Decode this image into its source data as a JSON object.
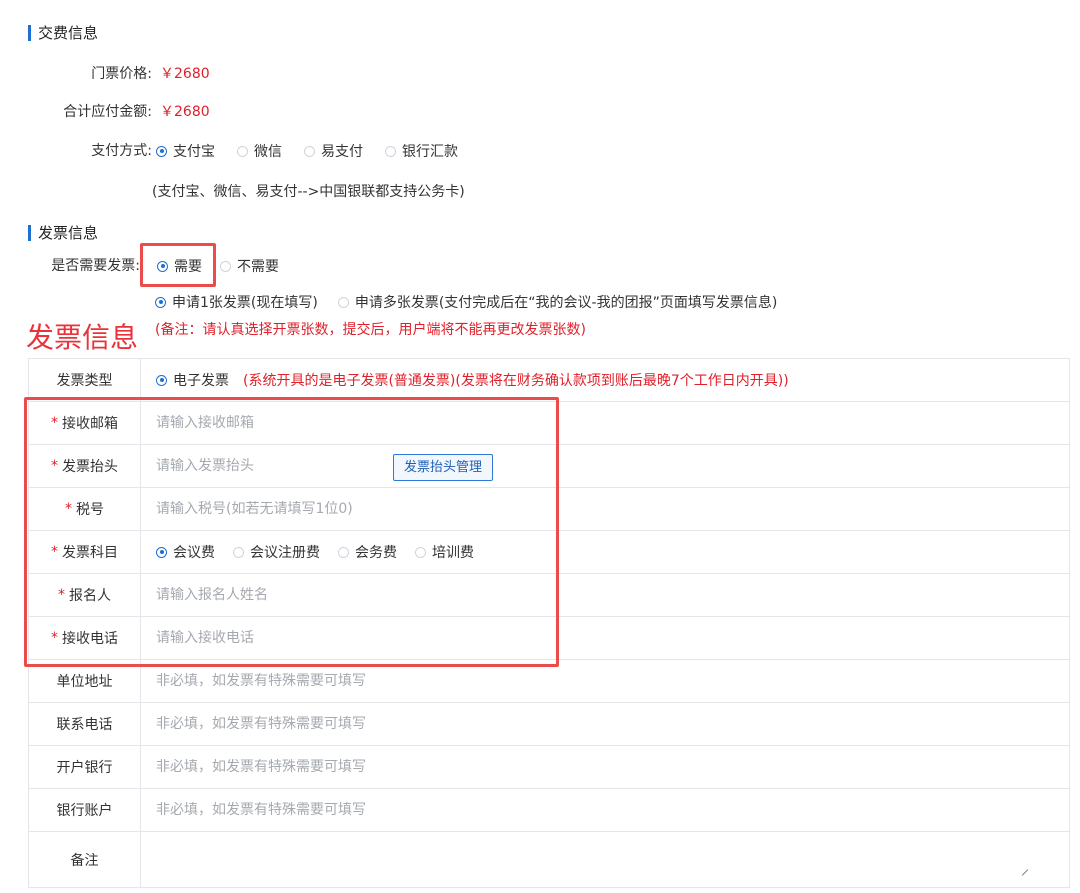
{
  "payment": {
    "section_title": "交费信息",
    "ticket_price_label": "门票价格:",
    "ticket_price": "￥2680",
    "total_label": "合计应付金额:",
    "total": "￥2680",
    "method_label": "支付方式:",
    "methods": [
      {
        "label": "支付宝",
        "selected": true
      },
      {
        "label": "微信",
        "selected": false
      },
      {
        "label": "易支付",
        "selected": false
      },
      {
        "label": "银行汇款",
        "selected": false
      }
    ],
    "method_note": "(支付宝、微信、易支付-->中国银联都支持公务卡)"
  },
  "invoice": {
    "section_title": "发票信息",
    "need_label": "是否需要发票:",
    "need_options": [
      {
        "label": "需要",
        "selected": true
      },
      {
        "label": "不需要",
        "selected": false
      }
    ],
    "count_options": [
      {
        "label": "申请1张发票(现在填写)",
        "selected": true
      },
      {
        "label": "申请多张发票(支付完成后在“我的会议-我的团报”页面填写发票信息)",
        "selected": false
      }
    ],
    "overlay_heading": "发票信息",
    "remark_note": "(备注：请认真选择开票张数，提交后，用户端将不能再更改发票张数)",
    "type_label": "发票类型",
    "type_option": "电子发票",
    "type_note": "(系统开具的是电子发票(普通发票)(发票将在财务确认款项到账后最晚7个工作日内开具))",
    "required_mark": "*",
    "email_label": "接收邮箱",
    "email_placeholder": "请输入接收邮箱",
    "title_label": "发票抬头",
    "title_placeholder": "请输入发票抬头",
    "title_manage_button": "发票抬头管理",
    "tax_label": "税号",
    "tax_placeholder": "请输入税号(如若无请填写1位0)",
    "subject_label": "发票科目",
    "subjects": [
      {
        "label": "会议费",
        "selected": true
      },
      {
        "label": "会议注册费",
        "selected": false
      },
      {
        "label": "会务费",
        "selected": false
      },
      {
        "label": "培训费",
        "selected": false
      }
    ],
    "registrant_label": "报名人",
    "registrant_placeholder": "请输入报名人姓名",
    "phone_label": "接收电话",
    "phone_placeholder": "请输入接收电话",
    "address_label": "单位地址",
    "contact_phone_label": "联系电话",
    "bank_label": "开户银行",
    "account_label": "银行账户",
    "optional_placeholder": "非必填，如发票有特殊需要可填写",
    "remark_label": "备注"
  },
  "colors": {
    "accent": "#1f6fd1",
    "price": "#e0202a",
    "highlight": "#ea4b4b"
  }
}
